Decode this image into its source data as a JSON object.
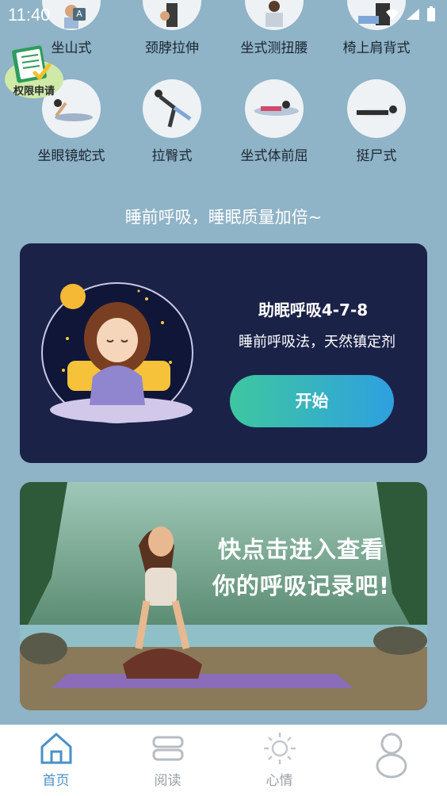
{
  "status": {
    "time": "11:40",
    "a_icon": "A"
  },
  "badge": {
    "text": "权限申请"
  },
  "poses_row1": [
    {
      "label": "坐山式"
    },
    {
      "label": "颈脖拉伸"
    },
    {
      "label": "坐式测扭腰"
    },
    {
      "label": "椅上肩背式"
    }
  ],
  "poses_row2": [
    {
      "label": "坐眼镜蛇式"
    },
    {
      "label": "拉臀式"
    },
    {
      "label": "坐式体前屈"
    },
    {
      "label": "挺尸式"
    }
  ],
  "headline": "睡前呼吸，睡眠质量加倍~",
  "card_breath": {
    "title": "助眠呼吸4-7-8",
    "subtitle": "睡前呼吸法，天然镇定剂",
    "button": "开始"
  },
  "card_record": {
    "line1": "快点击进入查看",
    "line2": "你的呼吸记录吧!"
  },
  "tabs": [
    {
      "label": "首页",
      "icon": "home-icon"
    },
    {
      "label": "阅读",
      "icon": "book-icon"
    },
    {
      "label": "心情",
      "icon": "sun-icon"
    },
    {
      "label": "",
      "icon": "profile-icon"
    }
  ],
  "colors": {
    "background": "#8fb3c7",
    "card_dark": "#1b2248",
    "accent": "#4a90c8"
  }
}
